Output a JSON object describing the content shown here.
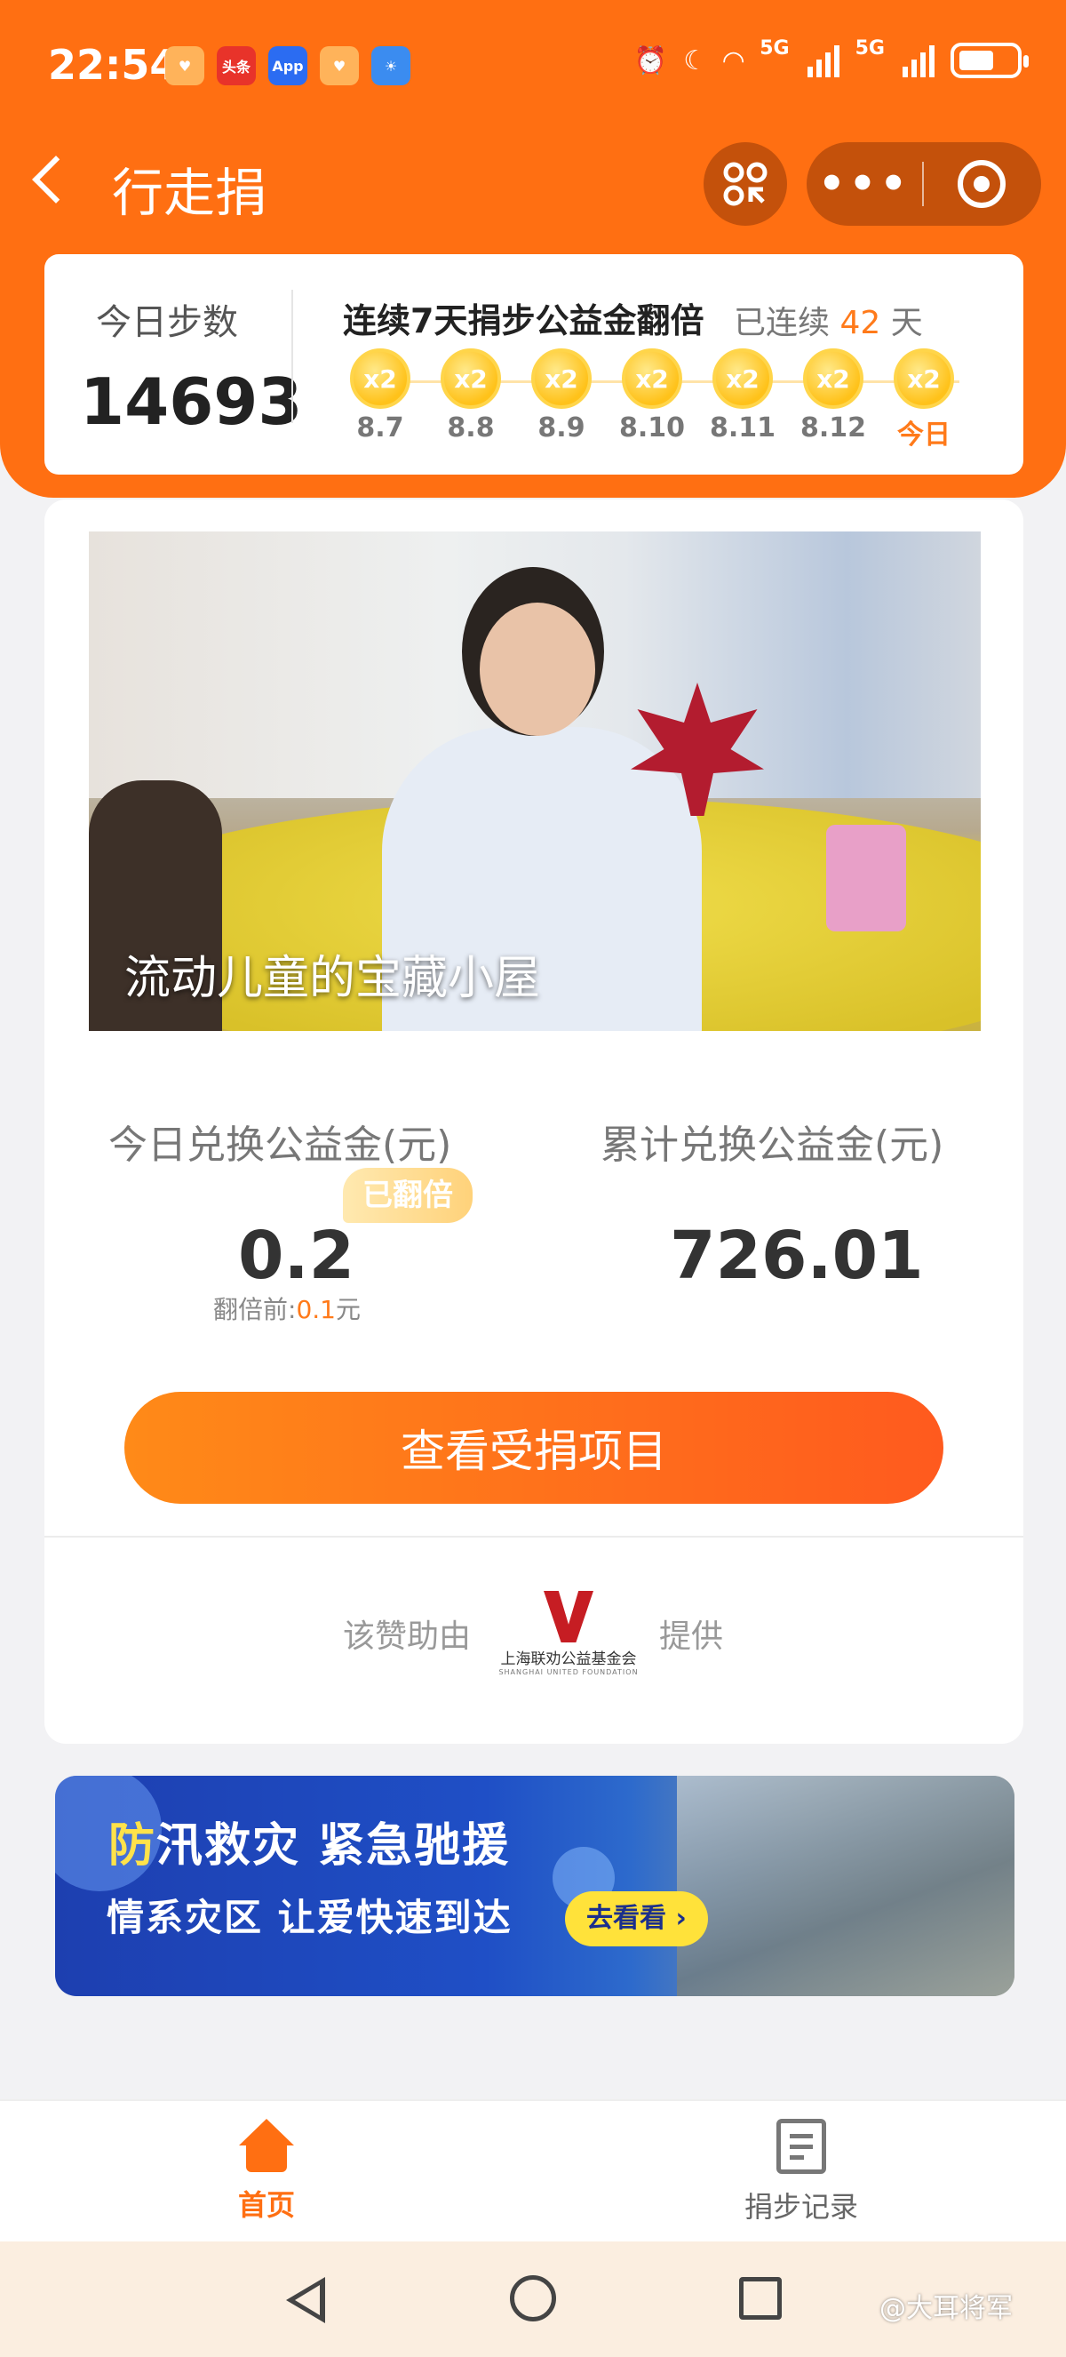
{
  "status_bar": {
    "time": "22:54",
    "apps": [
      {
        "name": "heart-app-icon",
        "label": "♥",
        "color": "#ffb35a"
      },
      {
        "name": "toutiao-app-icon",
        "label": "头条",
        "color": "#e8332a"
      },
      {
        "name": "app-market-icon",
        "label": "App",
        "color": "#2b6cf2"
      },
      {
        "name": "heart-app-icon-2",
        "label": "♥",
        "color": "#ffb35a"
      },
      {
        "name": "weather-app-icon",
        "label": "☀",
        "color": "#3b8cf0"
      }
    ],
    "network_1": "5G",
    "network_2": "5G"
  },
  "nav": {
    "title": "行走捐"
  },
  "steps": {
    "today_label": "今日步数",
    "today_value": "14693",
    "streak_title": "连续7天捐步公益金翻倍",
    "streak_prefix": "已连续",
    "streak_days": "42",
    "streak_suffix": "天",
    "multiplier": "x2",
    "days": [
      "8.7",
      "8.8",
      "8.9",
      "8.10",
      "8.11",
      "8.12",
      "今日"
    ]
  },
  "project": {
    "title": "流动儿童的宝藏小屋",
    "today_label": "今日兑换公益金(元)",
    "today_value": "0.2",
    "doubled_badge": "已翻倍",
    "before_double_label": "翻倍前:",
    "before_double_value": "0.1",
    "before_double_unit": "元",
    "total_label": "累计兑换公益金(元)",
    "total_value": "726.01",
    "view_button": "查看受捐项目",
    "sponsor_pre": "该赞助由",
    "sponsor_name": "上海联劝公益基金会",
    "sponsor_name_en": "SHANGHAI UNITED FOUNDATION",
    "sponsor_post": "提供"
  },
  "banner": {
    "title_highlight": "防",
    "title_rest": "汛救灾 紧急驰援",
    "subtitle": "情系灾区 让爱快速到达",
    "cta": "去看看 ›"
  },
  "tabbar": {
    "home": "首页",
    "records": "捐步记录"
  },
  "watermark": "@大耳将军"
}
